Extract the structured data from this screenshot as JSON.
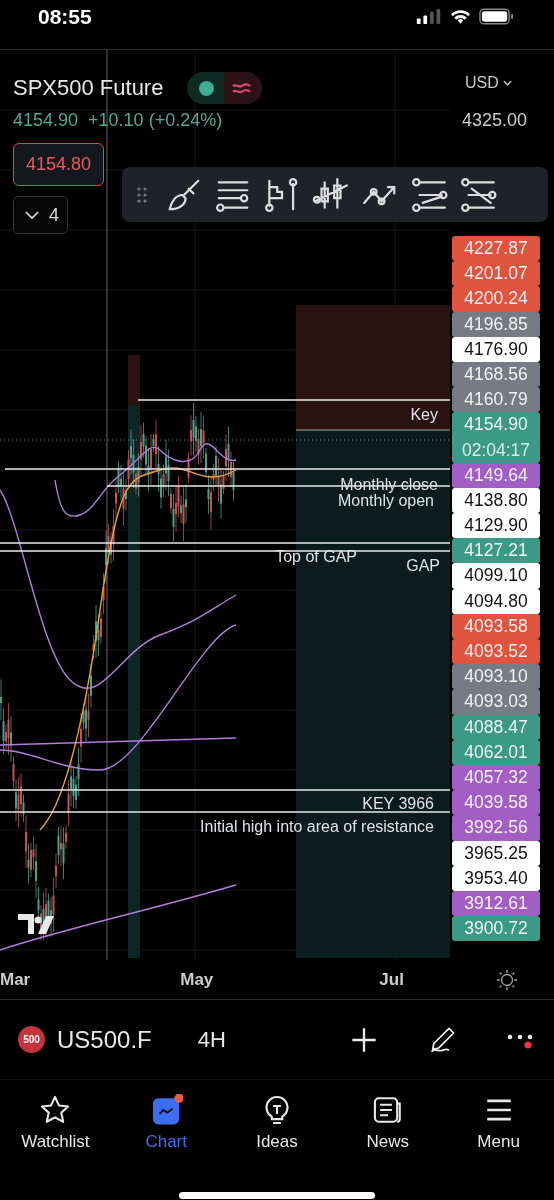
{
  "status_bar": {
    "time": "08:55"
  },
  "symbol_header": {
    "title": "SPX500 Future",
    "price": "4154.90",
    "change": "+10.10 (+0.24%)",
    "sell_price": "4154.80",
    "indicators_count": "4"
  },
  "price_axis": {
    "currency": "USD",
    "top_label": "4325.00",
    "labels": [
      {
        "value": "4227.87",
        "color": "#e0533f"
      },
      {
        "value": "4201.07",
        "color": "#e0533f"
      },
      {
        "value": "4200.24",
        "color": "#e0533f"
      },
      {
        "value": "4196.85",
        "color": "#787b86"
      },
      {
        "value": "4176.90",
        "color": "#ffffff"
      },
      {
        "value": "4168.56",
        "color": "#787b86"
      },
      {
        "value": "4160.79",
        "color": "#787b86"
      },
      {
        "value": "4154.90",
        "countdown": "02:04:17",
        "color": "#3a9a86"
      },
      {
        "value": "4149.64",
        "color": "#a35ec6"
      },
      {
        "value": "4138.80",
        "color": "#ffffff"
      },
      {
        "value": "4129.90",
        "color": "#ffffff"
      },
      {
        "value": "4127.21",
        "color": "#3a9a86"
      },
      {
        "value": "4099.10",
        "color": "#ffffff"
      },
      {
        "value": "4094.80",
        "color": "#ffffff"
      },
      {
        "value": "4093.58",
        "color": "#e0533f"
      },
      {
        "value": "4093.52",
        "color": "#e0533f"
      },
      {
        "value": "4093.10",
        "color": "#787b86"
      },
      {
        "value": "4093.03",
        "color": "#787b86"
      },
      {
        "value": "4088.47",
        "color": "#3a9a86"
      },
      {
        "value": "4062.01",
        "color": "#3a9a86"
      },
      {
        "value": "4057.32",
        "color": "#a35ec6"
      },
      {
        "value": "4039.58",
        "color": "#a35ec6"
      },
      {
        "value": "3992.56",
        "color": "#a35ec6"
      },
      {
        "value": "3965.25",
        "color": "#ffffff"
      },
      {
        "value": "3953.40",
        "color": "#ffffff"
      },
      {
        "value": "3912.61",
        "color": "#a35ec6"
      },
      {
        "value": "3900.72",
        "color": "#3a9a86"
      }
    ]
  },
  "annotations": [
    "Key",
    "Monthly close",
    "Monthly open",
    "Top of GAP",
    "GAP",
    "KEY 3966",
    "Initial high into area of resistance"
  ],
  "time_axis": [
    "Mar",
    "May",
    "Jul"
  ],
  "symbol_bar": {
    "badge": "500",
    "symbol": "US500.F",
    "interval": "4H",
    "more_notification": true
  },
  "tabs": [
    {
      "label": "Watchlist",
      "selected": false,
      "notification": false
    },
    {
      "label": "Chart",
      "selected": true,
      "notification": true
    },
    {
      "label": "Ideas",
      "selected": false,
      "notification": false
    },
    {
      "label": "News",
      "selected": false,
      "notification": false
    },
    {
      "label": "Menu",
      "selected": false,
      "notification": false
    }
  ]
}
